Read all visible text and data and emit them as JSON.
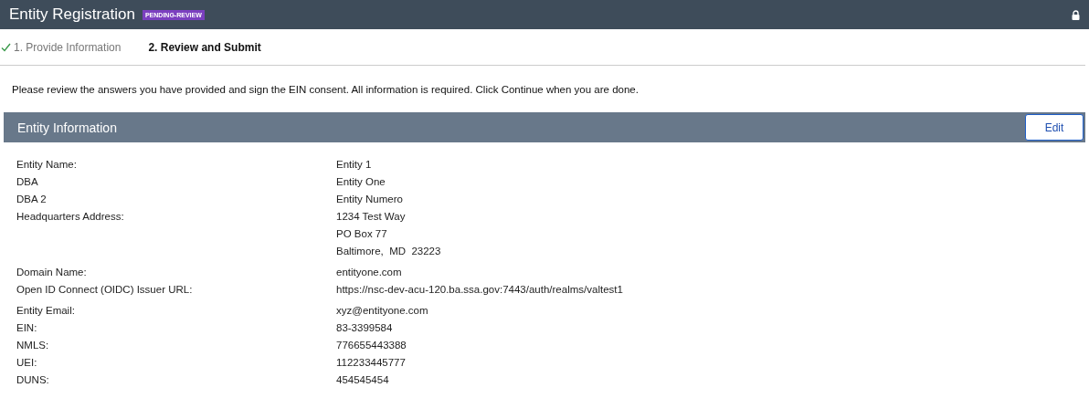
{
  "header": {
    "title": "Entity Registration",
    "badge": "PENDING-REVIEW",
    "locked": true
  },
  "steps": [
    {
      "label": "1. Provide Information",
      "completed": true,
      "selected": false
    },
    {
      "label": "2. Review and Submit",
      "completed": false,
      "selected": true
    }
  ],
  "instructions": "Please review the answers you have provided and sign the EIN consent. All information is required. Click Continue when you are done.",
  "section": {
    "title": "Entity Information",
    "edit_button": "Edit",
    "rows": [
      {
        "label": "Entity Name:",
        "values": [
          "Entity 1"
        ]
      },
      {
        "label": "DBA",
        "values": [
          "Entity One"
        ]
      },
      {
        "label": "DBA 2",
        "values": [
          "Entity Numero"
        ]
      },
      {
        "label": "Headquarters Address:",
        "values": [
          "1234 Test Way",
          "PO Box 77",
          "Baltimore,  MD  23223"
        ]
      },
      {
        "label": "Domain Name:",
        "values": [
          "entityone.com"
        ]
      },
      {
        "label": "Open ID Connect (OIDC) Issuer URL:",
        "values": [
          "https://nsc-dev-acu-120.ba.ssa.gov:7443/auth/realms/valtest1"
        ]
      },
      {
        "label": "Entity Email:",
        "values": [
          "xyz@entityone.com"
        ]
      },
      {
        "label": "EIN:",
        "values": [
          "83-3399584"
        ]
      },
      {
        "label": "NMLS:",
        "values": [
          "776655443388"
        ]
      },
      {
        "label": "UEI:",
        "values": [
          "112233445777"
        ]
      },
      {
        "label": "DUNS:",
        "values": [
          "454545454"
        ]
      }
    ]
  }
}
